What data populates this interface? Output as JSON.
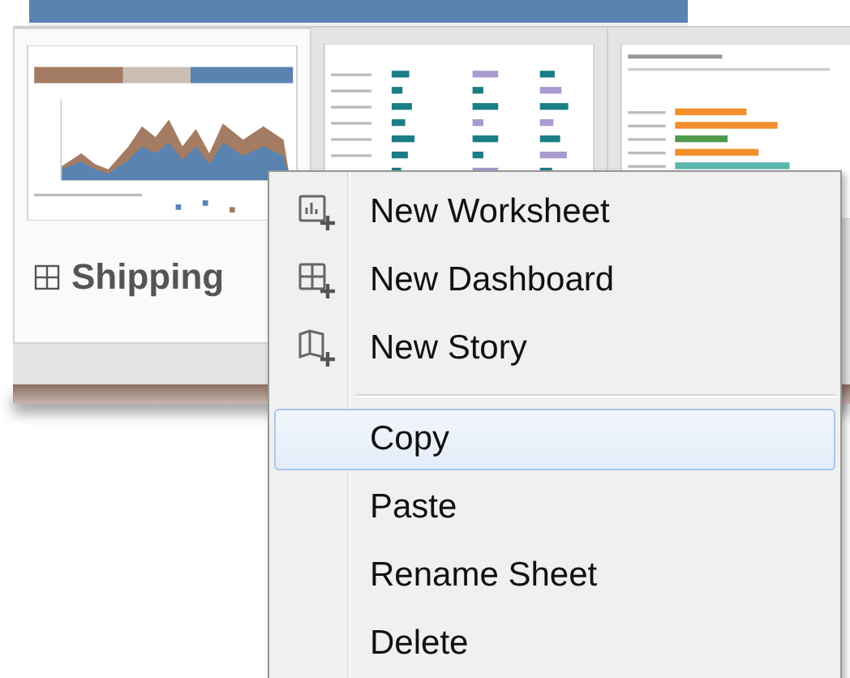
{
  "sheets": [
    {
      "name": "Shipping",
      "selected": true,
      "kind": "area"
    },
    {
      "kind": "bars",
      "selected": false
    },
    {
      "kind": "hbars",
      "selected": false
    }
  ],
  "context_menu": {
    "sections": [
      {
        "items": [
          {
            "label": "New Worksheet",
            "selected": false
          },
          {
            "label": "New Dashboard",
            "selected": false
          },
          {
            "label": "New Story",
            "selected": false
          }
        ]
      },
      {
        "items": [
          {
            "label": "Copy",
            "selected": true
          },
          {
            "label": "Paste",
            "selected": false
          },
          {
            "label": "Rename Sheet",
            "selected": false
          },
          {
            "label": "Delete",
            "selected": false
          }
        ]
      }
    ]
  }
}
